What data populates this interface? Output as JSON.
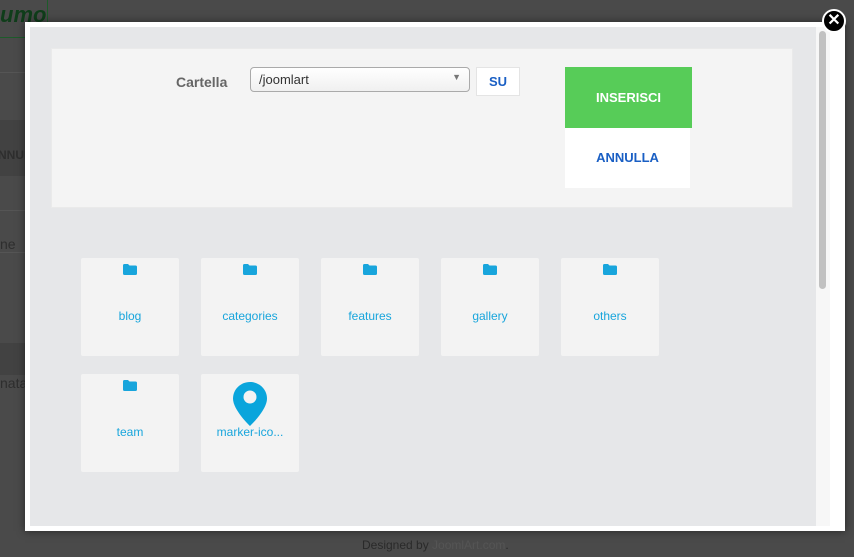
{
  "background": {
    "logo_text": "umo",
    "fragments": [
      "NNUL",
      "ne",
      "nata"
    ],
    "footer": {
      "prefix": "Designed by ",
      "link": "JoomlArt.com",
      "suffix": "."
    }
  },
  "dialog": {
    "close_icon": "close-icon",
    "folder_label": "Cartella",
    "folder_value": "/joomlart",
    "up_label": "SU",
    "insert_label": "INSERISCI",
    "cancel_label": "ANNULLA",
    "colors": {
      "insert": "#57cc58",
      "accent": "#18a5dc",
      "link": "#1a5fc4"
    },
    "items": [
      {
        "name": "blog",
        "icon": "folder-icon"
      },
      {
        "name": "categories",
        "icon": "folder-icon"
      },
      {
        "name": "features",
        "icon": "folder-icon"
      },
      {
        "name": "gallery",
        "icon": "folder-icon"
      },
      {
        "name": "others",
        "icon": "folder-icon"
      },
      {
        "name": "team",
        "icon": "folder-icon"
      },
      {
        "name": "marker-ico...",
        "icon": "map-marker-icon"
      }
    ]
  }
}
